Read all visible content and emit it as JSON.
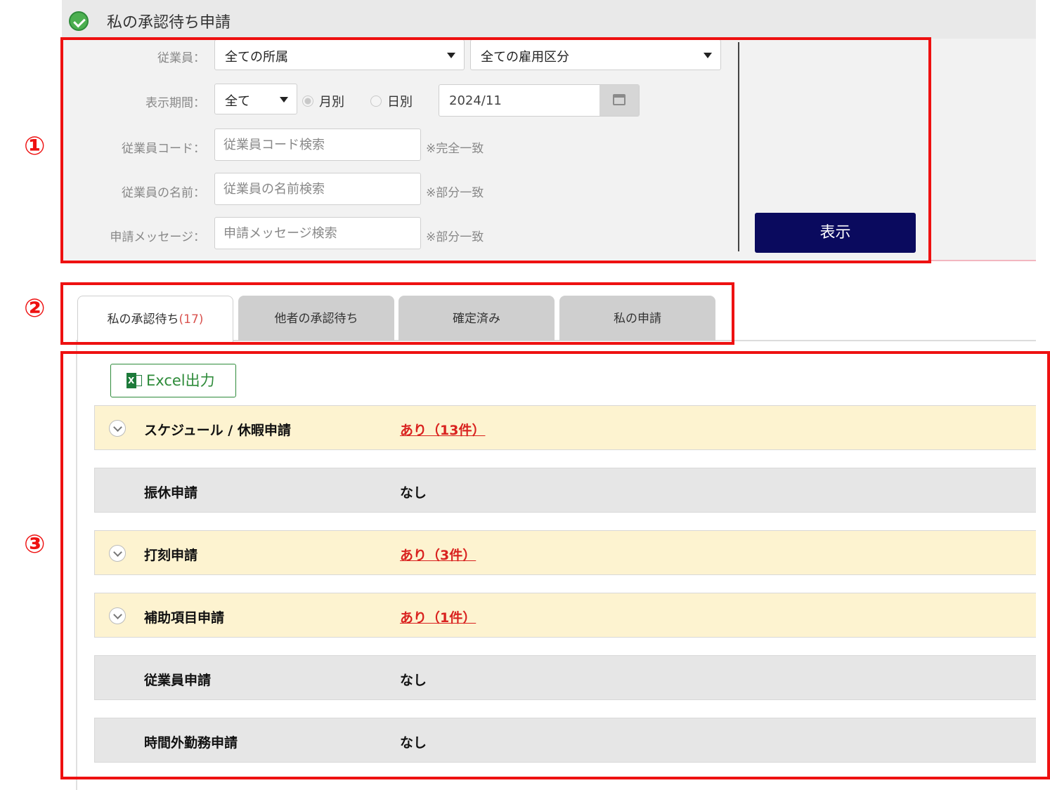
{
  "header": {
    "title": "私の承認待ち申請"
  },
  "filter": {
    "employee_label": "従業員：",
    "dept_select": "全ての所属",
    "employment_select": "全ての雇用区分",
    "period_label": "表示期間：",
    "period_select": "全て",
    "radio_monthly": "月別",
    "radio_daily": "日別",
    "date_value": "2024/11",
    "code_label": "従業員コード：",
    "code_placeholder": "従業員コード検索",
    "code_note": "※完全一致",
    "name_label": "従業員の名前：",
    "name_placeholder": "従業員の名前検索",
    "name_note": "※部分一致",
    "message_label": "申請メッセージ：",
    "message_placeholder": "申請メッセージ検索",
    "message_note": "※部分一致",
    "show_button": "表示"
  },
  "tabs": [
    {
      "label": "私の承認待ち",
      "count": "(17)"
    },
    {
      "label": "他者の承認待ち"
    },
    {
      "label": "確定済み"
    },
    {
      "label": "私の申請"
    }
  ],
  "excel_button": "Excel出力",
  "rows": [
    {
      "name": "スケジュール / 休暇申請",
      "status": "あり（13件）"
    },
    {
      "name": "振休申請",
      "status": "なし"
    },
    {
      "name": "打刻申請",
      "status": "あり（3件）"
    },
    {
      "name": "補助項目申請",
      "status": "あり（1件）"
    },
    {
      "name": "従業員申請",
      "status": "なし"
    },
    {
      "name": "時間外勤務申請",
      "status": "なし"
    }
  ],
  "annotations": {
    "one": "①",
    "two": "②",
    "three": "③"
  },
  "colors": {
    "accent_red": "#ee1111",
    "button_navy": "#0a0a5e",
    "excel_green": "#2e8b3a",
    "row_yellow": "#fdf3d0"
  }
}
